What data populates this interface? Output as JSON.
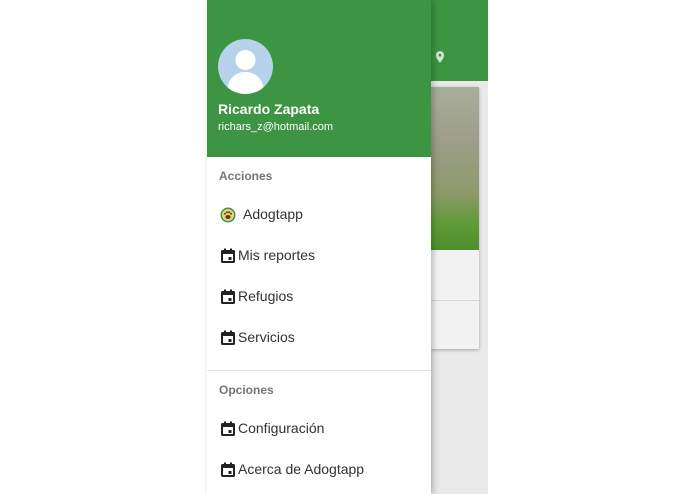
{
  "user": {
    "name": "Ricardo Zapata",
    "email": "richars_z@hotmail.com"
  },
  "sections": [
    {
      "title": "Acciones",
      "items": [
        {
          "label": "Adogtapp",
          "icon": "paw-icon"
        },
        {
          "label": "Mis reportes",
          "icon": "calendar-icon"
        },
        {
          "label": "Refugios",
          "icon": "calendar-icon"
        },
        {
          "label": "Servicios",
          "icon": "calendar-icon"
        }
      ]
    },
    {
      "title": "Opciones",
      "items": [
        {
          "label": "Configuración",
          "icon": "calendar-icon"
        },
        {
          "label": "Acerca de Adogtapp",
          "icon": "calendar-icon"
        }
      ]
    }
  ],
  "colors": {
    "primary": "#3d9443",
    "avatar_bg": "#b7d3ec"
  },
  "toolbar": {
    "icon": "location-pin-icon"
  }
}
